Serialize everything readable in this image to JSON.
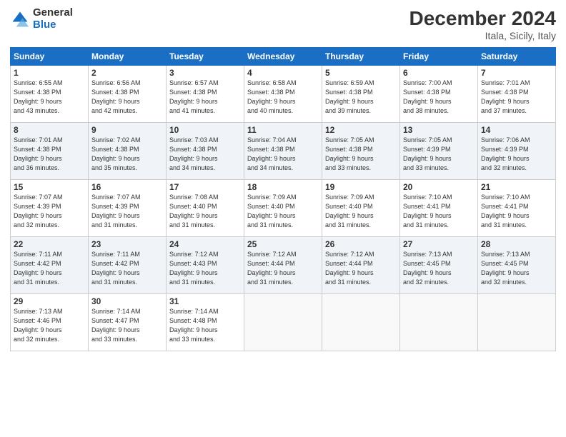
{
  "header": {
    "logo_line1": "General",
    "logo_line2": "Blue",
    "title": "December 2024",
    "subtitle": "Itala, Sicily, Italy"
  },
  "weekdays": [
    "Sunday",
    "Monday",
    "Tuesday",
    "Wednesday",
    "Thursday",
    "Friday",
    "Saturday"
  ],
  "weeks": [
    [
      {
        "day": "1",
        "sunrise": "Sunrise: 6:55 AM",
        "sunset": "Sunset: 4:38 PM",
        "daylight": "Daylight: 9 hours and 43 minutes."
      },
      {
        "day": "2",
        "sunrise": "Sunrise: 6:56 AM",
        "sunset": "Sunset: 4:38 PM",
        "daylight": "Daylight: 9 hours and 42 minutes."
      },
      {
        "day": "3",
        "sunrise": "Sunrise: 6:57 AM",
        "sunset": "Sunset: 4:38 PM",
        "daylight": "Daylight: 9 hours and 41 minutes."
      },
      {
        "day": "4",
        "sunrise": "Sunrise: 6:58 AM",
        "sunset": "Sunset: 4:38 PM",
        "daylight": "Daylight: 9 hours and 40 minutes."
      },
      {
        "day": "5",
        "sunrise": "Sunrise: 6:59 AM",
        "sunset": "Sunset: 4:38 PM",
        "daylight": "Daylight: 9 hours and 39 minutes."
      },
      {
        "day": "6",
        "sunrise": "Sunrise: 7:00 AM",
        "sunset": "Sunset: 4:38 PM",
        "daylight": "Daylight: 9 hours and 38 minutes."
      },
      {
        "day": "7",
        "sunrise": "Sunrise: 7:01 AM",
        "sunset": "Sunset: 4:38 PM",
        "daylight": "Daylight: 9 hours and 37 minutes."
      }
    ],
    [
      {
        "day": "8",
        "sunrise": "Sunrise: 7:01 AM",
        "sunset": "Sunset: 4:38 PM",
        "daylight": "Daylight: 9 hours and 36 minutes."
      },
      {
        "day": "9",
        "sunrise": "Sunrise: 7:02 AM",
        "sunset": "Sunset: 4:38 PM",
        "daylight": "Daylight: 9 hours and 35 minutes."
      },
      {
        "day": "10",
        "sunrise": "Sunrise: 7:03 AM",
        "sunset": "Sunset: 4:38 PM",
        "daylight": "Daylight: 9 hours and 34 minutes."
      },
      {
        "day": "11",
        "sunrise": "Sunrise: 7:04 AM",
        "sunset": "Sunset: 4:38 PM",
        "daylight": "Daylight: 9 hours and 34 minutes."
      },
      {
        "day": "12",
        "sunrise": "Sunrise: 7:05 AM",
        "sunset": "Sunset: 4:38 PM",
        "daylight": "Daylight: 9 hours and 33 minutes."
      },
      {
        "day": "13",
        "sunrise": "Sunrise: 7:05 AM",
        "sunset": "Sunset: 4:39 PM",
        "daylight": "Daylight: 9 hours and 33 minutes."
      },
      {
        "day": "14",
        "sunrise": "Sunrise: 7:06 AM",
        "sunset": "Sunset: 4:39 PM",
        "daylight": "Daylight: 9 hours and 32 minutes."
      }
    ],
    [
      {
        "day": "15",
        "sunrise": "Sunrise: 7:07 AM",
        "sunset": "Sunset: 4:39 PM",
        "daylight": "Daylight: 9 hours and 32 minutes."
      },
      {
        "day": "16",
        "sunrise": "Sunrise: 7:07 AM",
        "sunset": "Sunset: 4:39 PM",
        "daylight": "Daylight: 9 hours and 31 minutes."
      },
      {
        "day": "17",
        "sunrise": "Sunrise: 7:08 AM",
        "sunset": "Sunset: 4:40 PM",
        "daylight": "Daylight: 9 hours and 31 minutes."
      },
      {
        "day": "18",
        "sunrise": "Sunrise: 7:09 AM",
        "sunset": "Sunset: 4:40 PM",
        "daylight": "Daylight: 9 hours and 31 minutes."
      },
      {
        "day": "19",
        "sunrise": "Sunrise: 7:09 AM",
        "sunset": "Sunset: 4:40 PM",
        "daylight": "Daylight: 9 hours and 31 minutes."
      },
      {
        "day": "20",
        "sunrise": "Sunrise: 7:10 AM",
        "sunset": "Sunset: 4:41 PM",
        "daylight": "Daylight: 9 hours and 31 minutes."
      },
      {
        "day": "21",
        "sunrise": "Sunrise: 7:10 AM",
        "sunset": "Sunset: 4:41 PM",
        "daylight": "Daylight: 9 hours and 31 minutes."
      }
    ],
    [
      {
        "day": "22",
        "sunrise": "Sunrise: 7:11 AM",
        "sunset": "Sunset: 4:42 PM",
        "daylight": "Daylight: 9 hours and 31 minutes."
      },
      {
        "day": "23",
        "sunrise": "Sunrise: 7:11 AM",
        "sunset": "Sunset: 4:42 PM",
        "daylight": "Daylight: 9 hours and 31 minutes."
      },
      {
        "day": "24",
        "sunrise": "Sunrise: 7:12 AM",
        "sunset": "Sunset: 4:43 PM",
        "daylight": "Daylight: 9 hours and 31 minutes."
      },
      {
        "day": "25",
        "sunrise": "Sunrise: 7:12 AM",
        "sunset": "Sunset: 4:44 PM",
        "daylight": "Daylight: 9 hours and 31 minutes."
      },
      {
        "day": "26",
        "sunrise": "Sunrise: 7:12 AM",
        "sunset": "Sunset: 4:44 PM",
        "daylight": "Daylight: 9 hours and 31 minutes."
      },
      {
        "day": "27",
        "sunrise": "Sunrise: 7:13 AM",
        "sunset": "Sunset: 4:45 PM",
        "daylight": "Daylight: 9 hours and 32 minutes."
      },
      {
        "day": "28",
        "sunrise": "Sunrise: 7:13 AM",
        "sunset": "Sunset: 4:45 PM",
        "daylight": "Daylight: 9 hours and 32 minutes."
      }
    ],
    [
      {
        "day": "29",
        "sunrise": "Sunrise: 7:13 AM",
        "sunset": "Sunset: 4:46 PM",
        "daylight": "Daylight: 9 hours and 32 minutes."
      },
      {
        "day": "30",
        "sunrise": "Sunrise: 7:14 AM",
        "sunset": "Sunset: 4:47 PM",
        "daylight": "Daylight: 9 hours and 33 minutes."
      },
      {
        "day": "31",
        "sunrise": "Sunrise: 7:14 AM",
        "sunset": "Sunset: 4:48 PM",
        "daylight": "Daylight: 9 hours and 33 minutes."
      },
      null,
      null,
      null,
      null
    ]
  ]
}
